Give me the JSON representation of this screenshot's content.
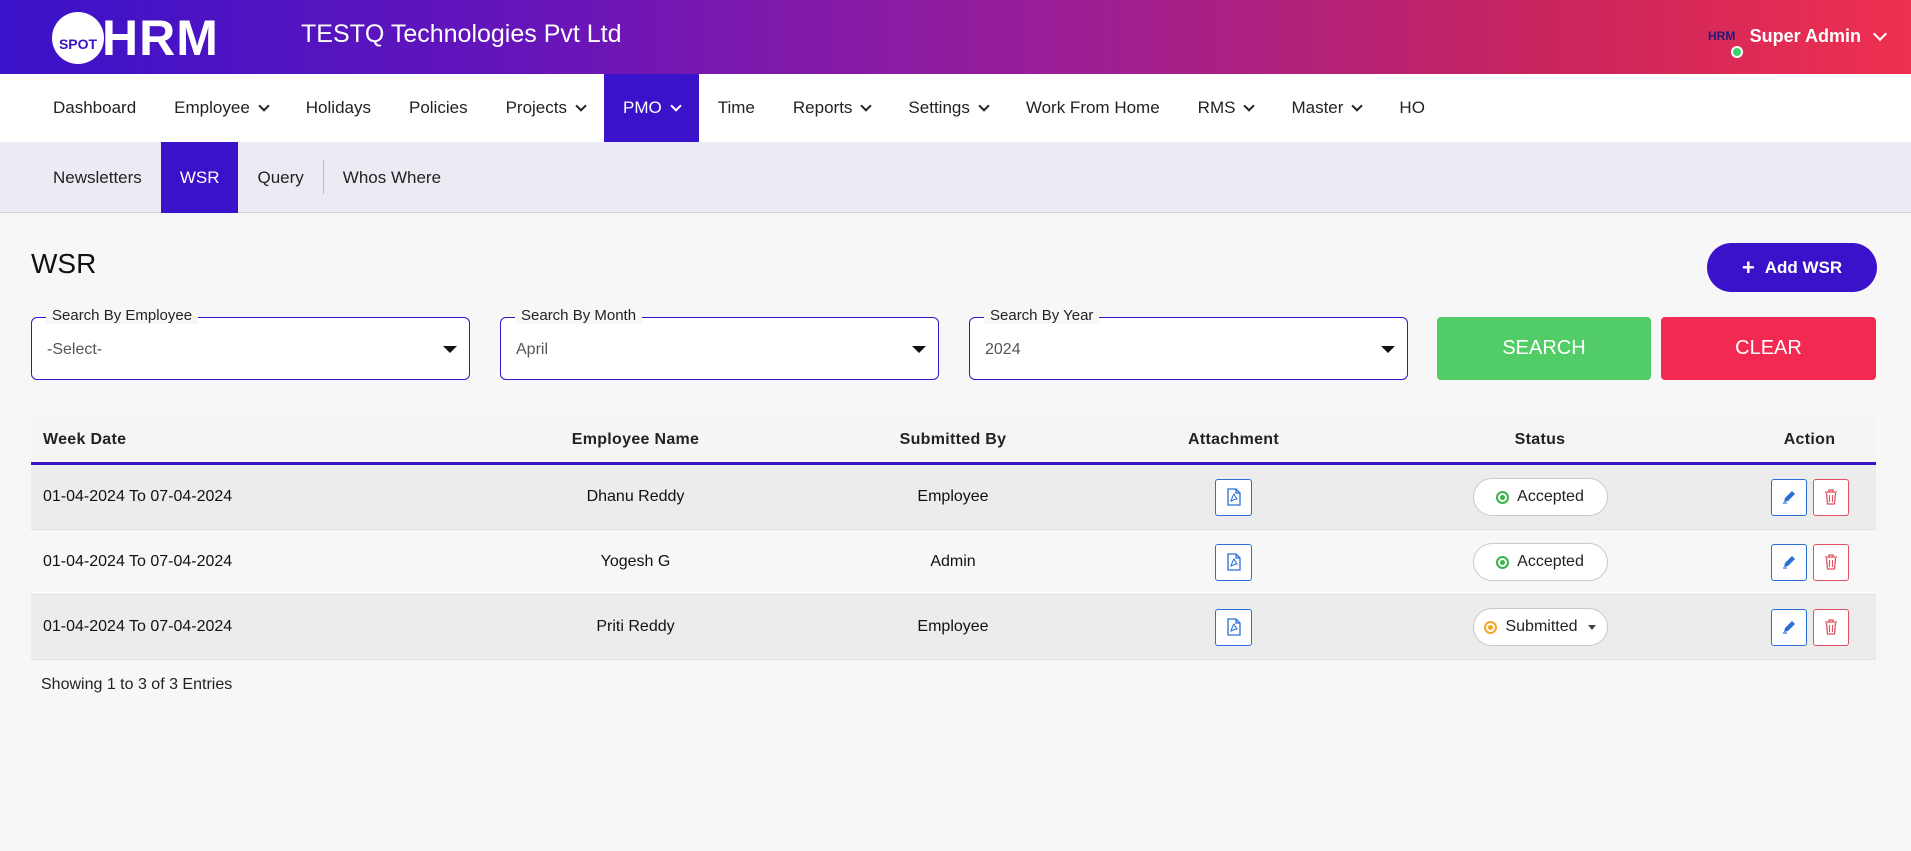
{
  "header": {
    "logo_small": "SPOT",
    "logo_big": "HRM",
    "company": "TESTQ Technologies Pvt Ltd",
    "avatar_text": "HRM",
    "user_name": "Super Admin"
  },
  "main_nav": [
    {
      "label": "Dashboard",
      "dropdown": false
    },
    {
      "label": "Employee",
      "dropdown": true
    },
    {
      "label": "Holidays",
      "dropdown": false
    },
    {
      "label": "Policies",
      "dropdown": false
    },
    {
      "label": "Projects",
      "dropdown": true
    },
    {
      "label": "PMO",
      "dropdown": true,
      "active": true
    },
    {
      "label": "Time",
      "dropdown": false
    },
    {
      "label": "Reports",
      "dropdown": true
    },
    {
      "label": "Settings",
      "dropdown": true
    },
    {
      "label": "Work From Home",
      "dropdown": false
    },
    {
      "label": "RMS",
      "dropdown": true
    },
    {
      "label": "Master",
      "dropdown": true
    },
    {
      "label": "HO",
      "dropdown": false
    }
  ],
  "sub_nav": [
    {
      "label": "Newsletters"
    },
    {
      "label": "WSR",
      "active": true
    },
    {
      "label": "Query"
    },
    {
      "label": "Whos Where"
    }
  ],
  "page": {
    "title": "WSR",
    "add_button": "Add WSR"
  },
  "filters": {
    "employee": {
      "label": "Search By Employee",
      "value": "-Select-"
    },
    "month": {
      "label": "Search By Month",
      "value": "April"
    },
    "year": {
      "label": "Search By Year",
      "value": "2024"
    },
    "search_button": "SEARCH",
    "clear_button": "CLEAR"
  },
  "table": {
    "columns": [
      "Week Date",
      "Employee Name",
      "Submitted By",
      "Attachment",
      "Status",
      "Action"
    ],
    "rows": [
      {
        "week": "01-04-2024 To 07-04-2024",
        "employee": "Dhanu Reddy",
        "submitted_by": "Employee",
        "status": "Accepted"
      },
      {
        "week": "01-04-2024 To 07-04-2024",
        "employee": "Yogesh G",
        "submitted_by": "Admin",
        "status": "Accepted"
      },
      {
        "week": "01-04-2024 To 07-04-2024",
        "employee": "Priti Reddy",
        "submitted_by": "Employee",
        "status": "Submitted"
      }
    ]
  },
  "footer": {
    "entries": "Showing 1 to 3 of 3 Entries"
  },
  "colors": {
    "primary": "#3a12c9",
    "search": "#52cc66",
    "clear": "#f22a52",
    "accepted": "#3ab54a",
    "submitted": "#f5a623"
  }
}
